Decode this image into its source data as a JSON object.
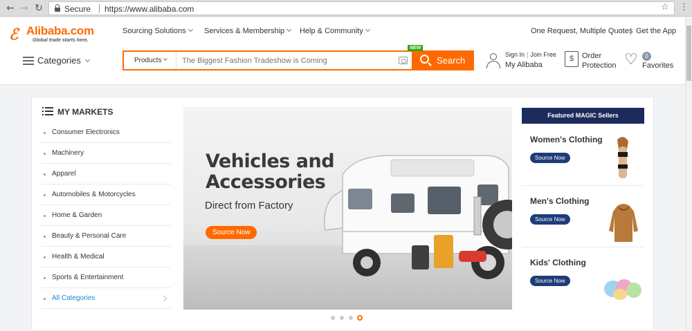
{
  "browser": {
    "back": "←",
    "forward": "→",
    "reload": "↻",
    "secure_label": "Secure",
    "url": "https://www.alibaba.com",
    "star": "☆",
    "menu": "⋮"
  },
  "logo": {
    "brand": "Alibaba.com",
    "tagline": "Global trade starts here."
  },
  "topnav": [
    {
      "label": "Sourcing Solutions"
    },
    {
      "label": "Services & Membership"
    },
    {
      "label": "Help & Community"
    }
  ],
  "toplinks": {
    "quotes": "One Request, Multiple Quotes",
    "app": "Get the App"
  },
  "categories_label": "Categories",
  "search": {
    "category": "Products",
    "placeholder": "The Biggest Fashion Tradeshow is Coming",
    "button": "Search",
    "badge": "NEW"
  },
  "account": {
    "sign_in": "Sign In",
    "join": "Join Free",
    "my": "My Alibaba"
  },
  "order": {
    "line1": "Order",
    "line2": "Protection"
  },
  "favorites": {
    "count": "0",
    "label": "Favorites"
  },
  "markets": {
    "title": "MY MARKETS",
    "items": [
      "Consumer Electronics",
      "Machinery",
      "Apparel",
      "Automobiles & Motorcycles",
      "Home & Garden",
      "Beauty & Personal Care",
      "Health & Medical",
      "Sports & Entertainment"
    ],
    "all": "All Categories"
  },
  "banner": {
    "title": "Vehicles and Accessories",
    "subtitle": "Direct from Factory",
    "button": "Source Now",
    "slides": 4,
    "active_slide": 4
  },
  "featured": {
    "title": "Featured MAGIC Sellers",
    "cards": [
      {
        "title": "Women's Clothing",
        "button": "Source Now"
      },
      {
        "title": "Men's Clothing",
        "button": "Source Now"
      },
      {
        "title": "Kids' Clothing",
        "button": "Source Now"
      }
    ]
  },
  "colors": {
    "accent": "#ff6a00",
    "navy": "#1d2b5c",
    "link": "#1a86d8",
    "new_badge": "#2ea70e"
  }
}
